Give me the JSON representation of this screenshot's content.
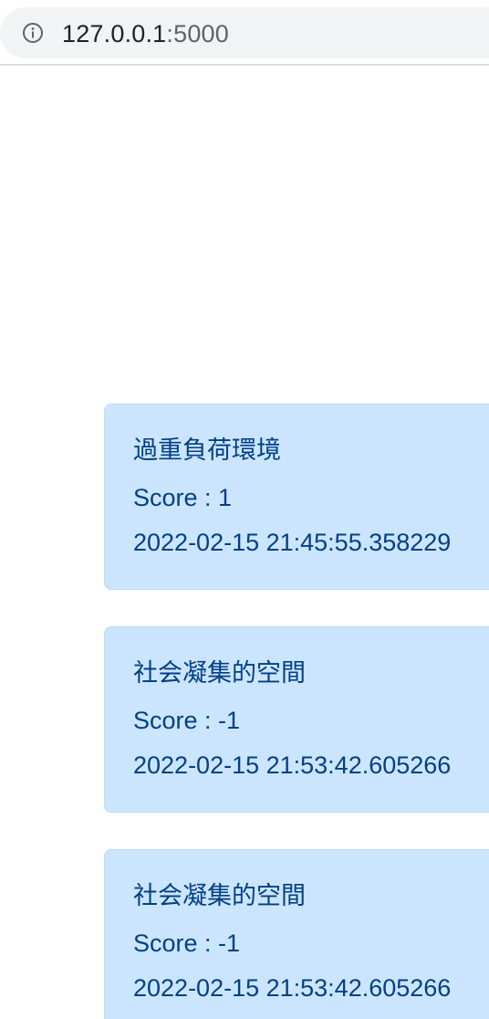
{
  "browser": {
    "url_host": "127.0.0.1",
    "url_port": ":5000",
    "info_icon": "info-icon"
  },
  "entries": [
    {
      "title": "過重負荷環境",
      "score_label": "Score : 1",
      "timestamp": "2022-02-15 21:45:55.358229"
    },
    {
      "title": "社会凝集的空間",
      "score_label": "Score : -1",
      "timestamp": "2022-02-15 21:53:42.605266"
    },
    {
      "title": "社会凝集的空間",
      "score_label": "Score : -1",
      "timestamp": "2022-02-15 21:53:42.605266"
    }
  ],
  "colors": {
    "card_background": "#cce5ff",
    "card_border": "#b8daff",
    "card_text": "#004085",
    "omnibox_background": "#f1f3f4"
  }
}
